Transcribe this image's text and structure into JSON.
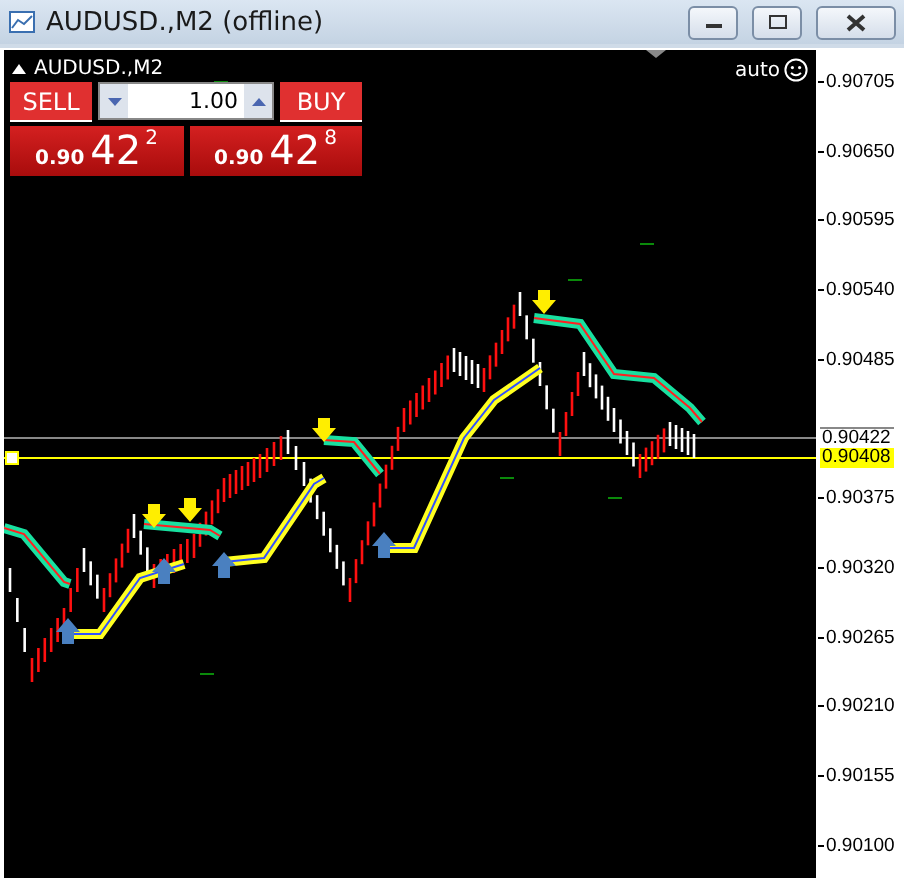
{
  "window": {
    "title": "AUDUSD.,M2 (offline)"
  },
  "chart": {
    "symbol_label": "AUDUSD.,M2",
    "auto_label": "auto",
    "trade_panel": {
      "sell_label": "SELL",
      "buy_label": "BUY",
      "lot": "1.00",
      "sell_price": {
        "prefix": "0.90",
        "big": "42",
        "sup": "2"
      },
      "buy_price": {
        "prefix": "0.90",
        "big": "42",
        "sup": "8"
      }
    },
    "price_axis": {
      "ticks": [
        "0.90705",
        "0.90650",
        "0.90595",
        "0.90540",
        "0.90485",
        "0.90375",
        "0.90320",
        "0.90265",
        "0.90210",
        "0.90155",
        "0.90100"
      ],
      "markers": [
        {
          "label": "0.90422",
          "kind": "ask"
        },
        {
          "label": "0.90408",
          "kind": "bid"
        }
      ]
    }
  }
}
